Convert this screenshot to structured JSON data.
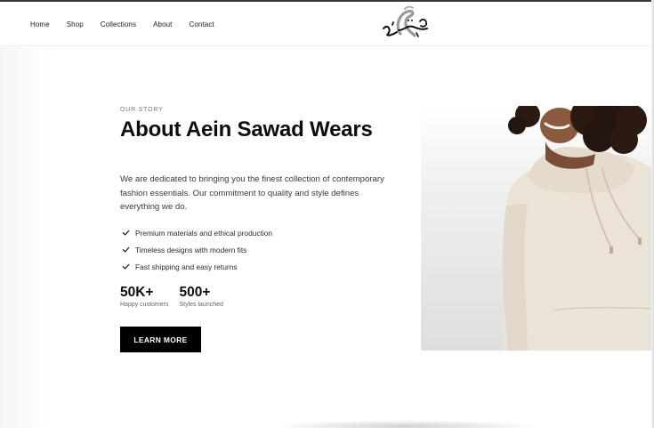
{
  "nav": {
    "items": [
      {
        "label": "Home"
      },
      {
        "label": "Shop"
      },
      {
        "label": "Collections"
      },
      {
        "label": "About"
      },
      {
        "label": "Contact"
      }
    ]
  },
  "logo": {
    "icon": "calligraphy-logo"
  },
  "about": {
    "eyebrow": "OUR STORY",
    "title": "About Aein Sawad Wears",
    "description": "We are dedicated to bringing you the finest collection of contemporary fashion essentials. Our commitment to quality and style defines everything we do.",
    "features": [
      {
        "icon": "check-icon",
        "label": "Premium materials and ethical production"
      },
      {
        "icon": "check-icon",
        "label": "Timeless designs with modern fits"
      },
      {
        "icon": "check-icon",
        "label": "Fast shipping and easy returns"
      }
    ],
    "stats": [
      {
        "value": "50K+",
        "label": "Happy customers"
      },
      {
        "value": "500+",
        "label": "Styles launched"
      }
    ],
    "cta_label": "LEARN MORE"
  },
  "hero": {
    "alt": "model-in-cream-hoodie"
  },
  "colors": {
    "accent": "#000000",
    "hoodie": "#ebe3d6",
    "background": "#ffffff"
  }
}
